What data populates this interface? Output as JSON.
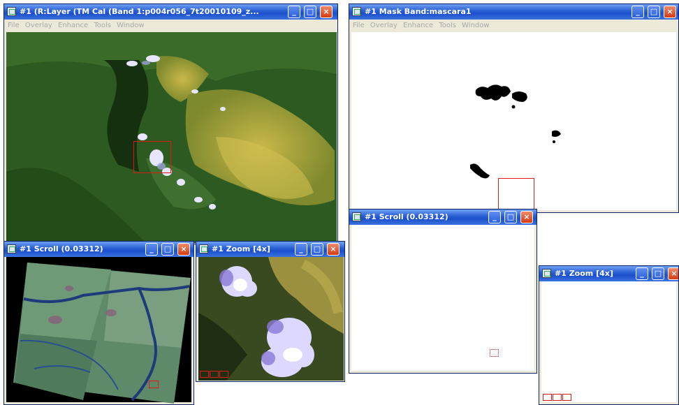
{
  "windows": {
    "image": {
      "title": "#1 (R:Layer (TM Cal (Band 1:p004r056_7t20010109_z...",
      "menu": [
        "File",
        "Overlay",
        "Enhance",
        "Tools",
        "Window"
      ]
    },
    "mask": {
      "title": "#1 Mask Band:mascara1",
      "menu": [
        "File",
        "Overlay",
        "Enhance",
        "Tools",
        "Window"
      ]
    },
    "scroll_left": {
      "title": "#1 Scroll (0.03312)"
    },
    "zoom_left": {
      "title": "#1 Zoom [4x]"
    },
    "scroll_right": {
      "title": "#1 Scroll (0.03312)"
    },
    "zoom_right": {
      "title": "#1 Zoom [4x]"
    }
  },
  "controls": {
    "minimize": "_",
    "maximize": "□",
    "close": "×"
  }
}
